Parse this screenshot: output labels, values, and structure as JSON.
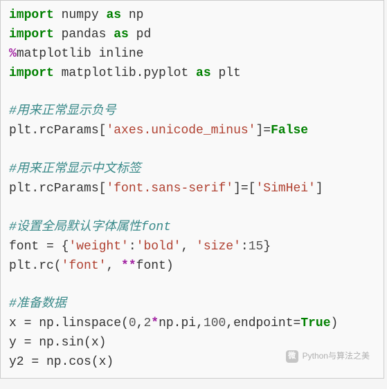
{
  "code": {
    "l1_import": "import",
    "l1_numpy": " numpy ",
    "l1_as": "as",
    "l1_np": " np",
    "l2_import": "import",
    "l2_pandas": " pandas ",
    "l2_as": "as",
    "l2_pd": " pd",
    "l3_pct": "%",
    "l3_rest": "matplotlib inline",
    "l4_import": "import",
    "l4_mid": " matplotlib.pyplot ",
    "l4_as": "as",
    "l4_plt": " plt",
    "c1": "#用来正常显示负号",
    "l5a": "plt.rcParams[",
    "l5s": "'axes.unicode_minus'",
    "l5b": "]=",
    "l5false": "False",
    "c2": "#用来正常显示中文标签",
    "l6a": "plt.rcParams[",
    "l6s1": "'font.sans-serif'",
    "l6b": "]=[",
    "l6s2": "'SimHei'",
    "l6c": "]",
    "c3": "#设置全局默认字体属性font",
    "l7a": "font = {",
    "l7s1": "'weight'",
    "l7b": ":",
    "l7s2": "'bold'",
    "l7c": ", ",
    "l7s3": "'size'",
    "l7d": ":",
    "l7n": "15",
    "l7e": "}",
    "l8a": "plt.rc(",
    "l8s": "'font'",
    "l8b": ", ",
    "l8stars": "**",
    "l8c": "font)",
    "c4": "#准备数据",
    "l9a": "x = np.linspace(",
    "l9n1": "0",
    "l9b": ",",
    "l9n2": "2",
    "l9star": "*",
    "l9c": "np.pi,",
    "l9n3": "100",
    "l9d": ",endpoint=",
    "l9true": "True",
    "l9e": ")",
    "l10": "y = np.sin(x)",
    "l11": "y2 = np.cos(x)"
  },
  "watermark": {
    "text": "Python与算法之美",
    "icon": "微"
  }
}
